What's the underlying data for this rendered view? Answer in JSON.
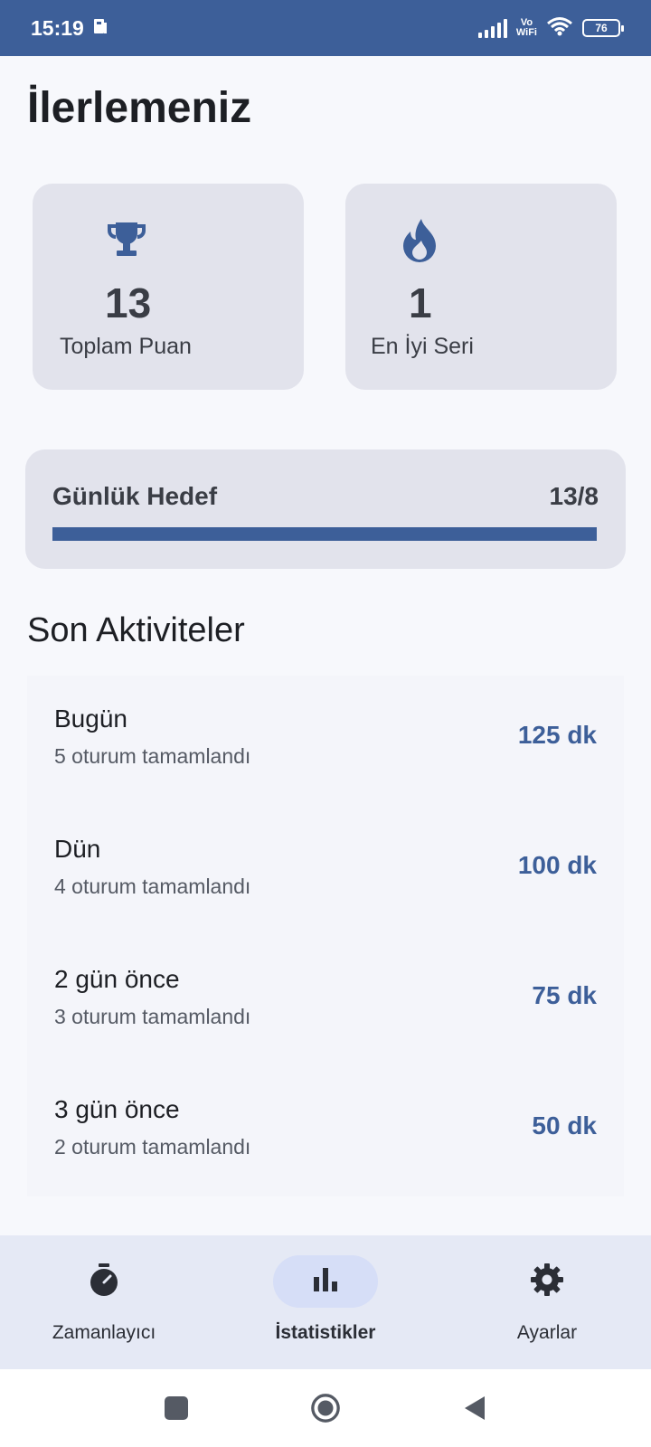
{
  "status_bar": {
    "time": "15:19",
    "vo": "Vo",
    "wifi_text": "WiFi",
    "battery": "76"
  },
  "page": {
    "title": "İlerlemeniz"
  },
  "stats": [
    {
      "icon": "trophy-icon",
      "value": "13",
      "label": "Toplam Puan"
    },
    {
      "icon": "flame-icon",
      "value": "1",
      "label": "En İyi Seri"
    }
  ],
  "daily_goal": {
    "label": "Günlük Hedef",
    "value_text": "13/8",
    "progress_fraction": 1.0
  },
  "activities": {
    "title": "Son Aktiviteler",
    "items": [
      {
        "title": "Bugün",
        "subtitle": "5 oturum tamamlandı",
        "value": "125 dk"
      },
      {
        "title": "Dün",
        "subtitle": "4 oturum tamamlandı",
        "value": "100 dk"
      },
      {
        "title": "2 gün önce",
        "subtitle": "3 oturum tamamlandı",
        "value": "75 dk"
      },
      {
        "title": "3 gün önce",
        "subtitle": "2 oturum tamamlandı",
        "value": "50 dk"
      }
    ]
  },
  "bottom_nav": {
    "items": [
      {
        "label": "Zamanlayıcı",
        "icon": "stopwatch-icon",
        "active": false
      },
      {
        "label": "İstatistikler",
        "icon": "bar-chart-icon",
        "active": true
      },
      {
        "label": "Ayarlar",
        "icon": "gear-icon",
        "active": false
      }
    ]
  },
  "colors": {
    "primary": "#3d5f99",
    "card": "#e2e3ec",
    "nav_bg": "#e5e9f5",
    "active_pill": "#d6def7"
  }
}
